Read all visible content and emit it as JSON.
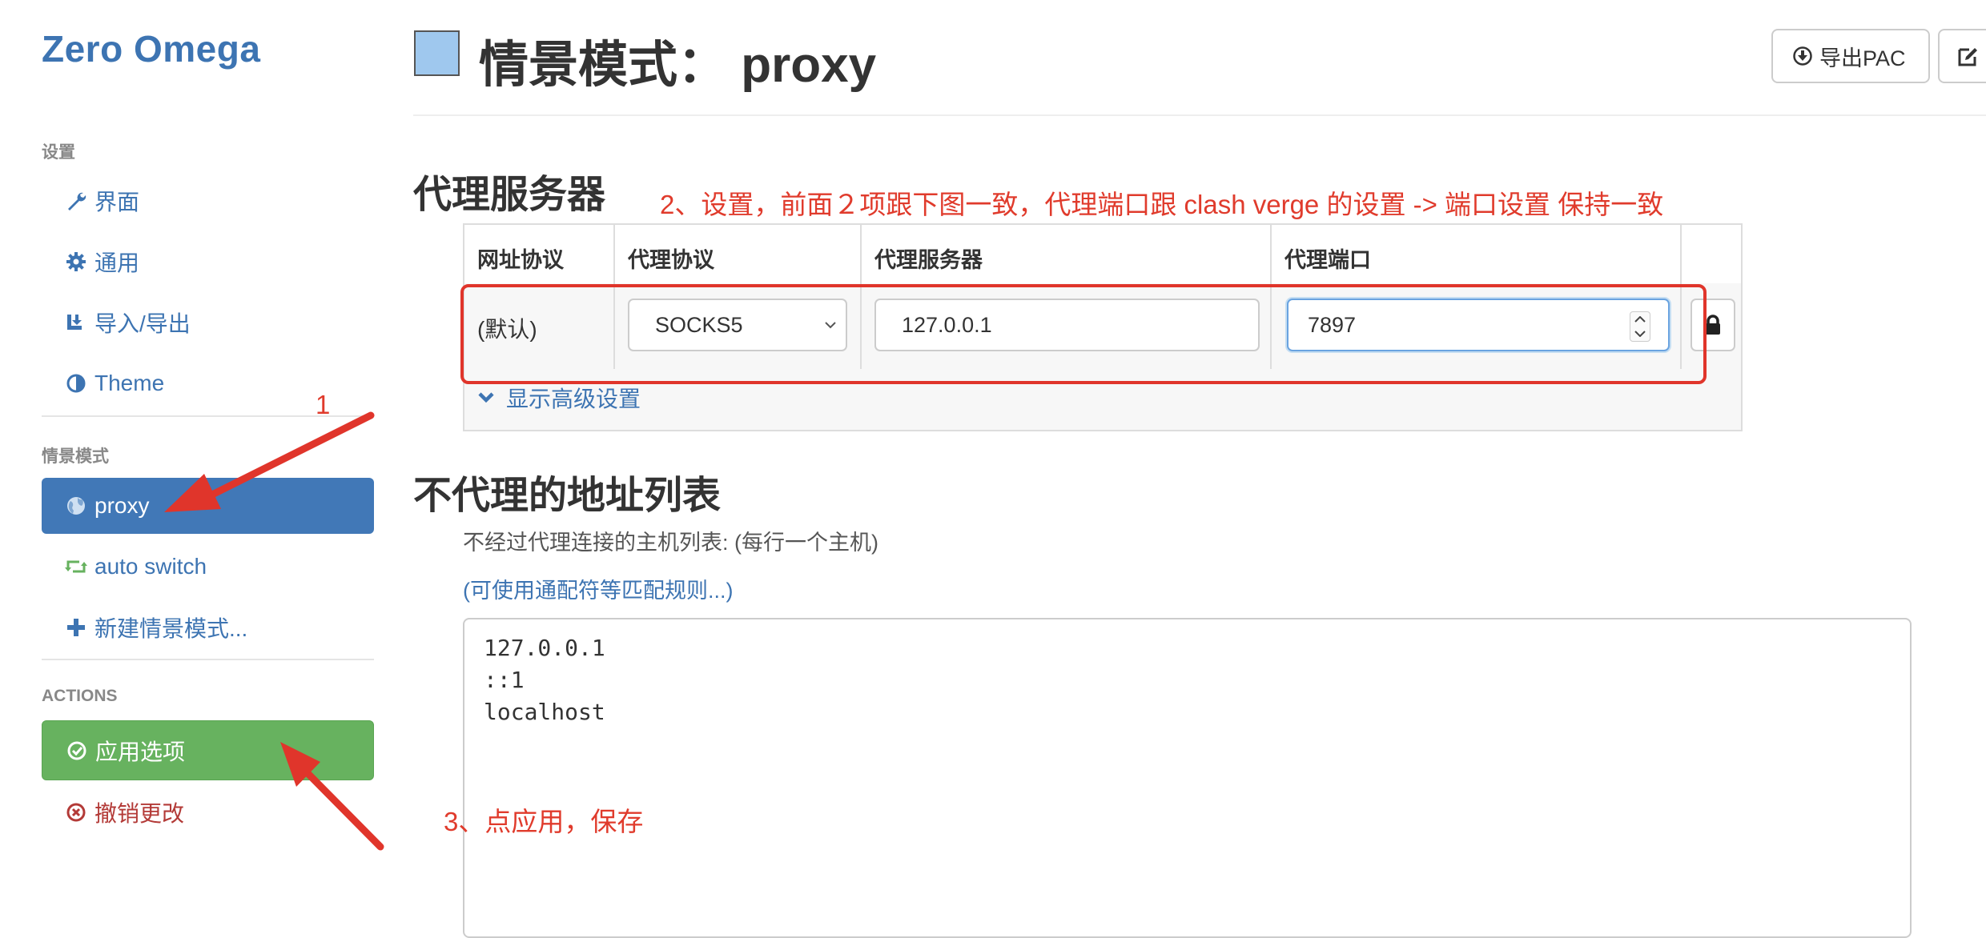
{
  "sidebar": {
    "brand": "Zero Omega",
    "settings_header": "设置",
    "settings_items": [
      {
        "label": "界面",
        "icon": "wrench-icon"
      },
      {
        "label": "通用",
        "icon": "gear-icon"
      },
      {
        "label": "导入/导出",
        "icon": "import-export-icon"
      },
      {
        "label": "Theme",
        "icon": "half-circle-icon"
      }
    ],
    "profiles_header": "情景模式",
    "profiles": [
      {
        "label": "proxy",
        "icon": "globe-icon",
        "active": true
      },
      {
        "label": "auto switch",
        "icon": "retweet-icon",
        "active": false
      },
      {
        "label": "新建情景模式...",
        "icon": "plus-icon",
        "active": false
      }
    ],
    "actions_header": "ACTIONS",
    "apply_label": "应用选项",
    "discard_label": "撤销更改"
  },
  "header": {
    "title_prefix": "情景模式：",
    "profile_name": "proxy",
    "swatch_color": "#9fc8ee",
    "export_pac_label": "导出PAC"
  },
  "proxy_servers": {
    "heading": "代理服务器",
    "columns": [
      "网址协议",
      "代理协议",
      "代理服务器",
      "代理端口"
    ],
    "row": {
      "scheme": "(默认)",
      "protocol": "SOCKS5",
      "server": "127.0.0.1",
      "port": "7897"
    },
    "advanced_label": "显示高级设置"
  },
  "bypass": {
    "heading": "不代理的地址列表",
    "description": "不经过代理连接的主机列表: (每行一个主机)",
    "wildcard_link": "(可使用通配符等匹配规则...)",
    "lines": [
      "127.0.0.1",
      "::1",
      "localhost"
    ]
  },
  "annotations": {
    "step1": "1",
    "step2": "2、设置，前面２项跟下图一致，代理端口跟 clash verge 的设置 -> 端口设置 保持一致",
    "step3": "3、点应用，保存",
    "color": "#e0352b"
  },
  "colors": {
    "accent": "#3d74b2",
    "active_bg": "#4178b7",
    "apply_bg": "#67b25f",
    "discard": "#b33a37"
  }
}
